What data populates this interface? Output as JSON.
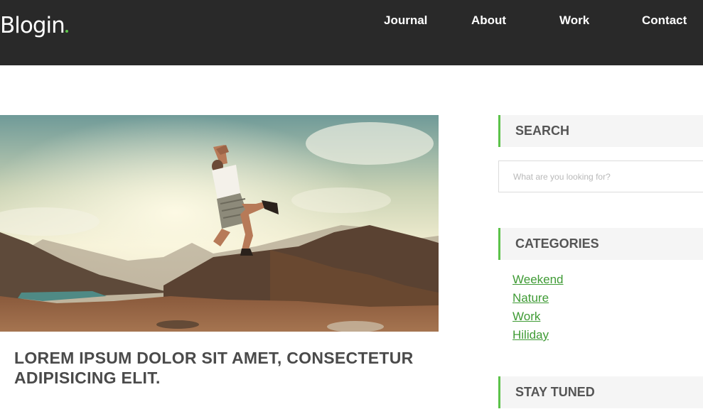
{
  "header": {
    "logo_text": "Blogin",
    "nav": {
      "journal": "Journal",
      "about": "About",
      "work": "Work",
      "contact": "Contact"
    }
  },
  "post": {
    "image_icon": "photo-man-jumping-mountains",
    "title": "LOREM IPSUM DOLOR SIT AMET, CONSECTETUR ADIPISICING ELIT."
  },
  "sidebar": {
    "search": {
      "heading": "SEARCH",
      "placeholder": "What are you looking for?"
    },
    "categories": {
      "heading": "CATEGORIES",
      "items": [
        "Weekend",
        "Nature",
        "Work",
        "Hiliday"
      ]
    },
    "stay_tuned": {
      "heading": "STAY TUNED"
    }
  },
  "colors": {
    "header_bg": "#292929",
    "accent": "#5cc24a",
    "link": "#3f9b35",
    "heading_bg": "#f5f5f5"
  }
}
